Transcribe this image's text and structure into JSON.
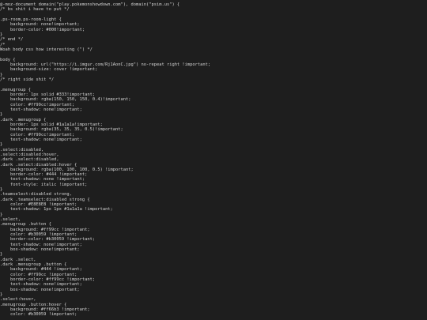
{
  "window": {
    "background": "#1e1e1e",
    "text_color": "#d4d4d4"
  },
  "code_lines": [
    "@-moz-document domain(\"play.pokemonshowdown.com\"), domain(\"psim.us\") {",
    "/* bs shit i have to put */",
    "",
    ".ps-room.ps-room-light {",
    "    background: none!important;",
    "    border-color: #000!important;",
    "}",
    "/* end */",
    "/*",
    "Woah body css how interesting (\") */",
    "",
    "body {",
    "    background: url(\"https://i.imgur.com/Rj1AonC.jpg\") no-repeat right !important;",
    "    background-size: cover !important;",
    "}",
    "/* right side shit */",
    "",
    ".menugroup {",
    "    border: 1px solid #333!important;",
    "    background: rgba(150, 150, 150, 0.4)!important;",
    "    color: #ff99cc!important;",
    "    text-shadow: none!important;",
    "}",
    ".dark .menugroup {",
    "    border: 1px solid #1a1a1a!important;",
    "    background: rgba(35, 35, 35, 0.5)!important;",
    "    color: #ff99cc!important;",
    "    text-shadow: none!important;",
    "}",
    ".select:disabled,",
    ".select:disabled:hover,",
    ".dark .select:disabled,",
    ".dark .select:disabled:hover {",
    "    background: rgba(100, 100, 100, 0.5) !important;",
    "    border-color: #444 !important;",
    "    text-shadow: none !important;",
    "    font-style: italic !important;",
    "}",
    ".teamselect:disabled strong,",
    ".dark .teamselect:disabled strong {",
    "    color: #E8E8E8 !important;",
    "    text-shadow: 1px 1px #1a1a1a !important;",
    "}",
    ".select,",
    ".menugroup .button {",
    "    background: #ff99cc !important;",
    "    color: #b30059 !important;",
    "    border-color: #b30059 !important;",
    "    text-shadow: none!important;",
    "    box-shadow: none!important;",
    "}",
    ".dark .select,",
    ".dark .menugroup .button {",
    "    background: #444 !important;",
    "    color: #ff99cc !important;",
    "    border-color: #ff99cc !important;",
    "    text-shadow: none!important;",
    "    box-shadow: none!important;",
    "}",
    ".select:hover,",
    ".menugroup .button:hover {",
    "    background: #ff66b3 !important;",
    "    color: #b30059 !important;"
  ]
}
